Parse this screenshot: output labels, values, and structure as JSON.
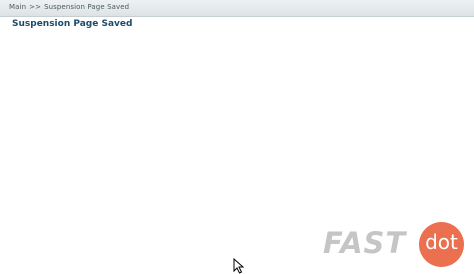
{
  "breadcrumb": {
    "root": "Main",
    "separator": ">>",
    "current": "Suspension Page Saved"
  },
  "page": {
    "title": "Suspension Page Saved"
  },
  "watermark": {
    "word1": "FAST",
    "word2": "dot",
    "accent_color": "#e86440"
  },
  "icons": {
    "cursor": "mouse-pointer-icon"
  }
}
